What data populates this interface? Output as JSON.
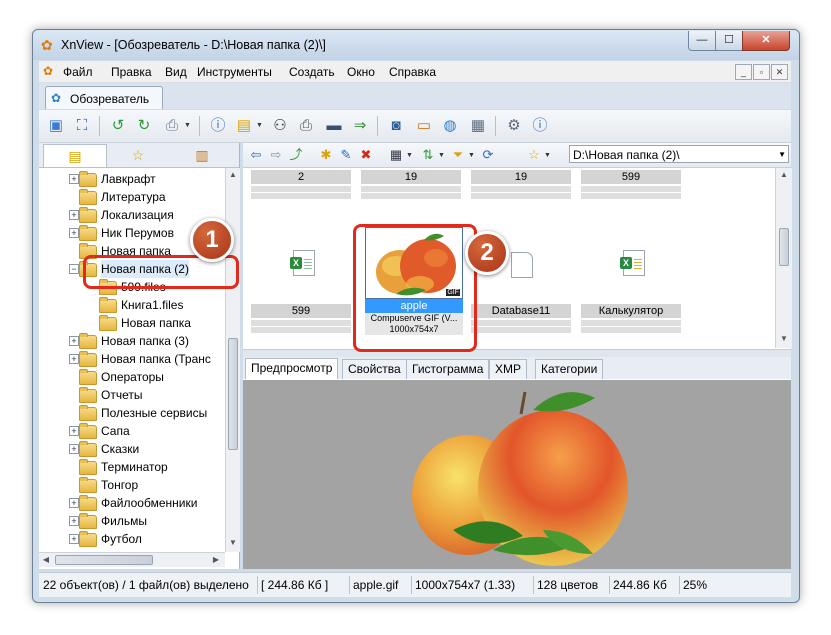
{
  "window": {
    "title": "XnView - [Обозреватель - D:\\Новая папка (2)\\]",
    "min_glyph": "—",
    "max_glyph": "☐",
    "close_glyph": "✕"
  },
  "menubar": {
    "items": [
      "Файл",
      "Правка",
      "Вид",
      "Инструменты",
      "Создать",
      "Окно",
      "Справка"
    ],
    "mdi": [
      "_",
      "▫",
      "✕"
    ]
  },
  "tabs": {
    "browser_tab": "Обозреватель"
  },
  "toolbar": {
    "icons": [
      "view-icon",
      "fullscreen-icon",
      "rotate-left-icon",
      "rotate-right-icon",
      "acquire-icon",
      "properties-icon",
      "open-icon",
      "binoculars-icon",
      "print-icon",
      "scan-icon",
      "convert-icon",
      "screenshot-icon",
      "slideshow-icon",
      "web-icon",
      "contact-sheet-icon",
      "settings-icon",
      "info-icon"
    ]
  },
  "left_panel": {
    "tabs": [
      "folders-tab",
      "favorites-tab",
      "categories-tab"
    ],
    "tree": [
      {
        "label": "Лавкрафт",
        "level": 0,
        "expander": "+"
      },
      {
        "label": "Литература",
        "level": 0,
        "expander": ""
      },
      {
        "label": "Локализация",
        "level": 0,
        "expander": "+"
      },
      {
        "label": "Ник Перумов",
        "level": 0,
        "expander": "+"
      },
      {
        "label": "Новая папка",
        "level": 0,
        "expander": ""
      },
      {
        "label": "Новая папка (2)",
        "level": 0,
        "expander": "−",
        "selected": true
      },
      {
        "label": "599.files",
        "level": 1,
        "expander": ""
      },
      {
        "label": "Книга1.files",
        "level": 1,
        "expander": ""
      },
      {
        "label": "Новая папка",
        "level": 1,
        "expander": ""
      },
      {
        "label": "Новая папка (3)",
        "level": 0,
        "expander": "+"
      },
      {
        "label": "Новая папка (Транс",
        "level": 0,
        "expander": "+"
      },
      {
        "label": "Операторы",
        "level": 0,
        "expander": ""
      },
      {
        "label": "Отчеты",
        "level": 0,
        "expander": ""
      },
      {
        "label": "Полезные сервисы",
        "level": 0,
        "expander": ""
      },
      {
        "label": "Сапа",
        "level": 0,
        "expander": "+"
      },
      {
        "label": "Сказки",
        "level": 0,
        "expander": "+"
      },
      {
        "label": "Терминатор",
        "level": 0,
        "expander": ""
      },
      {
        "label": "Тонгор",
        "level": 0,
        "expander": ""
      },
      {
        "label": "Файлообменники",
        "level": 0,
        "expander": "+"
      },
      {
        "label": "Фильмы",
        "level": 0,
        "expander": "+"
      },
      {
        "label": "Футбол",
        "level": 0,
        "expander": "+"
      }
    ]
  },
  "nav": {
    "path": "D:\\Новая папка (2)\\"
  },
  "browser": {
    "top_row": [
      "2",
      "19",
      "19",
      "599"
    ],
    "items": [
      {
        "name": "599",
        "icon": "excel-file-icon"
      },
      {
        "name": "apple",
        "type": "Compuserve GIF (V...",
        "dims": "1000x754x7",
        "badge": "GIF",
        "selected": true
      },
      {
        "name": "Database11",
        "icon": "blank-file-icon"
      },
      {
        "name": "Калькулятор",
        "icon": "excel-warning-file-icon"
      }
    ]
  },
  "preview_tabs": [
    "Предпросмотр",
    "Свойства",
    "Гистограмма",
    "XMP",
    "Категории"
  ],
  "status": {
    "objects": "22 объект(ов) / 1 файл(ов) выделено",
    "size1": "[ 244.86 Кб ]",
    "filename": "apple.gif",
    "dims": "1000x754x7 (1.33)",
    "colors": "128 цветов",
    "size2": "244.86 Кб",
    "zoom": "25%"
  },
  "annotations": {
    "callout1": "1",
    "callout2": "2"
  },
  "colors": {
    "callout_red": "#e12a1c",
    "selection_blue": "#3399ff",
    "preview_bg": "#a3a3a3"
  }
}
